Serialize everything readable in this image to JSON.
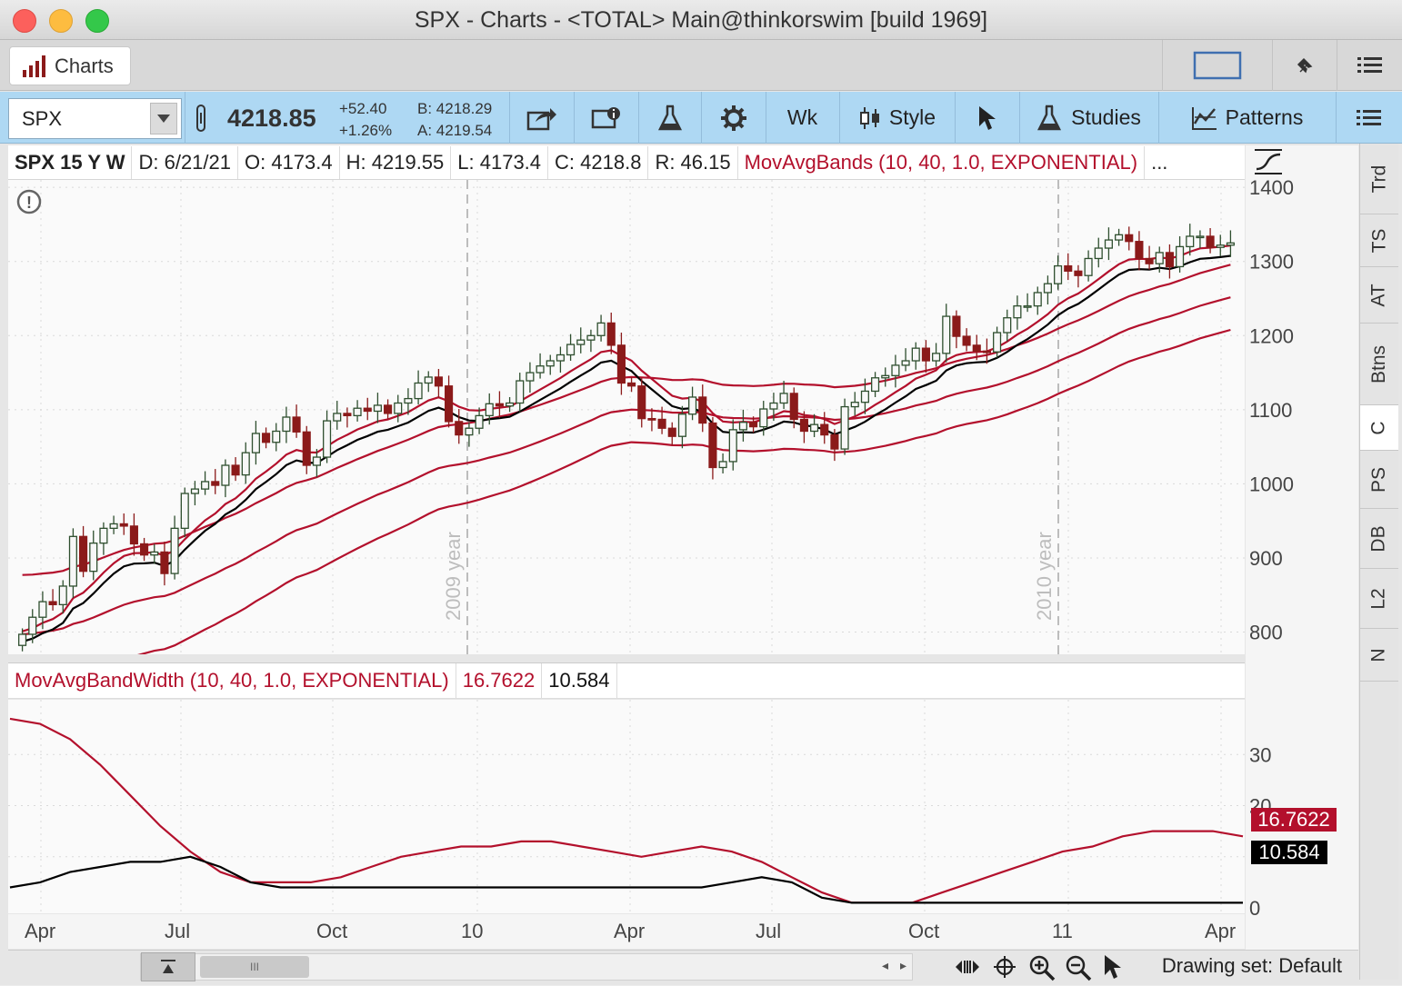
{
  "window": {
    "title": "SPX - Charts - <TOTAL> Main@thinkorswim [build 1969]"
  },
  "tabs": {
    "charts_label": "Charts"
  },
  "toolbar": {
    "symbol": "SPX",
    "last_price": "4218.85",
    "net_change": "+52.40",
    "pct_change": "+1.26%",
    "bid": "B: 4218.29",
    "ask": "A: 4219.54",
    "aggregation": "Wk",
    "style_label": "Style",
    "studies_label": "Studies",
    "patterns_label": "Patterns"
  },
  "infobar": {
    "symbol_period": "SPX 15 Y W",
    "date": "D: 6/21/21",
    "open": "O: 4173.4",
    "high": "H: 4219.55",
    "low": "L: 4173.4",
    "close": "C: 4218.8",
    "range": "R: 46.15",
    "study": "MovAvgBands (10, 40, 1.0, EXPONENTIAL)",
    "more": "..."
  },
  "lower": {
    "study": "MovAvgBandWidth (10, 40, 1.0, EXPONENTIAL)",
    "value1": "16.7622",
    "value2": "10.584"
  },
  "price_axis": [
    "1400",
    "1300",
    "1200",
    "1100",
    "1000",
    "900",
    "800"
  ],
  "lower_axis": [
    "30",
    "20",
    "0"
  ],
  "time_axis": [
    "Apr",
    "Jul",
    "Oct",
    "10",
    "Apr",
    "Jul",
    "Oct",
    "11",
    "Apr"
  ],
  "year_markers": [
    "2009 year",
    "2010 year"
  ],
  "tags": {
    "red_tag": "16.7622",
    "black_tag": "10.584"
  },
  "sidebar": [
    "Trd",
    "TS",
    "AT",
    "Btns",
    "C",
    "PS",
    "DB",
    "L2",
    "N"
  ],
  "bottom": {
    "drawing_set": "Drawing set: Default"
  },
  "colors": {
    "band": "#b3102c",
    "ema": "#000000",
    "up": "#2f4f2f",
    "down": "#8b1a1a",
    "toolbar": "#aed8f3"
  },
  "chart_data": [
    {
      "type": "candlestick",
      "title": "SPX 15 Y W",
      "ylim": [
        770,
        1410
      ],
      "y_ticks": [
        800,
        900,
        1000,
        1100,
        1200,
        1300,
        1400
      ],
      "x_ticks": [
        "Apr",
        "Jul",
        "Oct",
        "10",
        "Apr",
        "Jul",
        "Oct",
        "11",
        "Apr"
      ],
      "candles_close": [
        797,
        820,
        841,
        837,
        862,
        929,
        882,
        920,
        940,
        946,
        943,
        919,
        904,
        908,
        879,
        940,
        987,
        993,
        1003,
        998,
        1025,
        1012,
        1042,
        1068,
        1056,
        1071,
        1090,
        1070,
        1025,
        1036,
        1085,
        1095,
        1092,
        1102,
        1098,
        1106,
        1095,
        1109,
        1115,
        1136,
        1144,
        1132,
        1084,
        1066,
        1075,
        1092,
        1108,
        1105,
        1109,
        1139,
        1150,
        1159,
        1166,
        1174,
        1188,
        1194,
        1200,
        1217,
        1187,
        1136,
        1132,
        1088,
        1087,
        1075,
        1064,
        1094,
        1117,
        1082,
        1022,
        1030,
        1073,
        1083,
        1077,
        1101,
        1109,
        1122,
        1087,
        1071,
        1080,
        1066,
        1047,
        1104,
        1110,
        1125,
        1143,
        1146,
        1160,
        1166,
        1183,
        1166,
        1176,
        1226,
        1199,
        1187,
        1179,
        1178,
        1204,
        1224,
        1240,
        1240,
        1258,
        1270,
        1294,
        1287,
        1281,
        1304,
        1318,
        1329,
        1336,
        1327,
        1304,
        1297,
        1312,
        1293,
        1320,
        1334,
        1334,
        1319,
        1322,
        1325
      ]
    },
    {
      "type": "line",
      "title": "MovAvgBandWidth (10, 40, 1.0, EXPONENTIAL)",
      "ylim": [
        0,
        40
      ],
      "y_ticks": [
        0,
        20,
        30
      ],
      "series": [
        {
          "name": "16.7622",
          "values": [
            37,
            36,
            33,
            28,
            22,
            16,
            11,
            7,
            5,
            5,
            5,
            6,
            8,
            10,
            11,
            12,
            12,
            13,
            13,
            12,
            11,
            10,
            11,
            12,
            11,
            9,
            6,
            3,
            1,
            1,
            1,
            3,
            5,
            7,
            9,
            11,
            12,
            14,
            15,
            15,
            15,
            14
          ]
        },
        {
          "name": "10.584",
          "values": [
            4,
            5,
            7,
            8,
            9,
            9,
            10,
            8,
            5,
            4,
            4,
            4,
            4,
            4,
            4,
            4,
            4,
            4,
            4,
            4,
            4,
            4,
            4,
            4,
            5,
            6,
            5,
            2,
            1,
            1,
            1,
            1,
            1,
            1,
            1,
            1,
            1,
            1,
            1,
            1,
            1,
            1
          ]
        }
      ]
    }
  ]
}
